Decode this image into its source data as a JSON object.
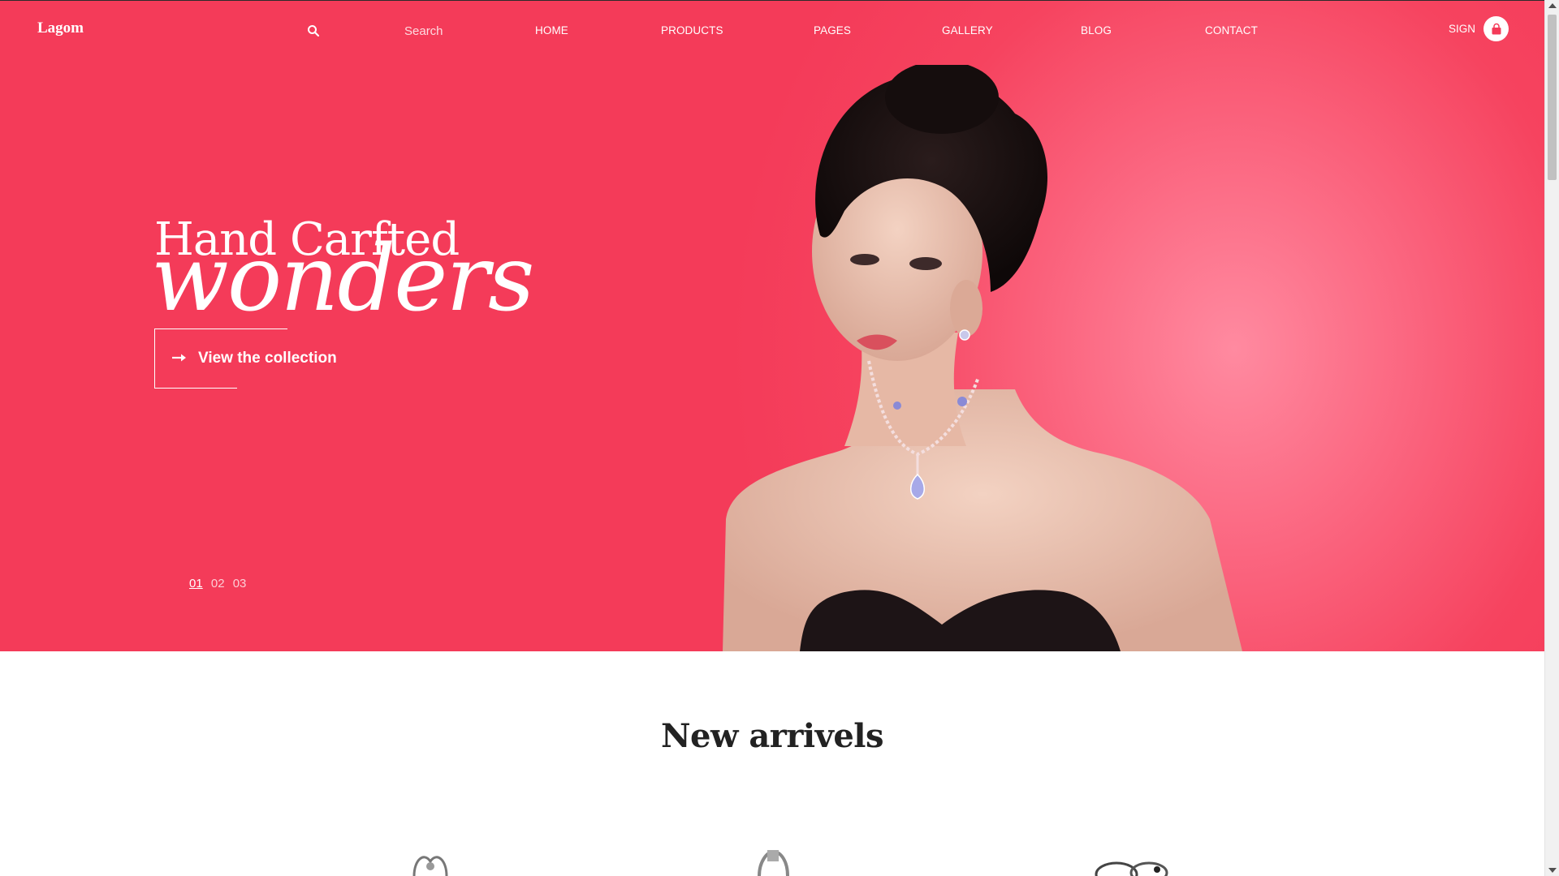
{
  "header": {
    "logo": "Lagom",
    "search_placeholder": "Search",
    "nav": [
      "HOME",
      "PRODUCTS",
      "PAGES",
      "GALLERY",
      "BLOG",
      "CONTACT"
    ],
    "sign_label": "SIGN"
  },
  "hero": {
    "title": "Hand Carfted",
    "script": "wonders",
    "cta_label": "View the collection",
    "slides": [
      "01",
      "02",
      "03"
    ],
    "active_slide": "01"
  },
  "new_arrivals": {
    "title": "New arrivels"
  },
  "colors": {
    "hero_bg": "#f43b59",
    "hero_glow": "#ff8aa0",
    "text_dark": "#222222",
    "white": "#ffffff"
  }
}
